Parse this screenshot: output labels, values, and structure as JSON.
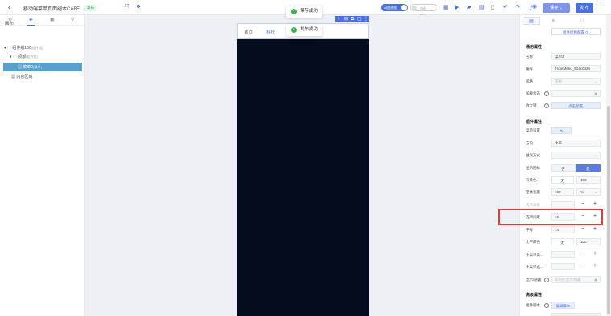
{
  "header": {
    "back_icon": "chevron-left-icon",
    "title": "移动端菜单页面副本CAFE",
    "status_badge": "发布",
    "toggle_debug": "动态数据",
    "toggle_auto": "自动保存",
    "save_label": "保存",
    "publish_label": "发 布",
    "more_label": "···",
    "toolbar_icons": [
      "fullscreen-icon",
      "sitemap-icon",
      "grid-icon",
      "play-icon",
      "bookmark-icon",
      "calendar-icon",
      "device-icon",
      "undo-icon",
      "redo-icon",
      "share-icon",
      "preview-icon"
    ]
  },
  "toasts": [
    {
      "text": "保存成功"
    },
    {
      "text": "发布成功"
    }
  ],
  "left_panel": {
    "tabs": [
      "settings-icon",
      "layers-icon",
      "components-icon",
      "tree-icon"
    ],
    "section_label": "画布",
    "tree": [
      {
        "label": "组件组100",
        "sub": "(组件组)"
      },
      {
        "label": "顶部",
        "sub": "(组件组)"
      },
      {
        "label": "菜单2",
        "sub": "(菜单)"
      },
      {
        "label": "内容区域",
        "sub": ""
      }
    ]
  },
  "canvas": {
    "menu_items": [
      "首页",
      "科技"
    ],
    "tool_icons": [
      "+",
      "⊟",
      "⧉",
      "▢",
      "⋮"
    ]
  },
  "right_panel": {
    "tabs": [
      "props-icon",
      "style-icon",
      "event-icon"
    ],
    "top_button": "组件结构配置",
    "group_general": "通用属性",
    "name_label": "名称",
    "name_value": "菜单2",
    "id_label": "编号",
    "id_value": "FrontMenu_914c0424",
    "style_label": "风格",
    "style_value": "风格",
    "loading_label": "加载状态",
    "zoom_label": "放大镜",
    "zoom_button": "点击配置",
    "group_component": "组件属性",
    "menu_settings_label": "菜单设置",
    "direction_label": "方向",
    "direction_value": "水平",
    "trigger_label": "触发方式",
    "show_icon_label": "显示图标",
    "show_icon_options": [
      "否",
      "是"
    ],
    "bg_color_label": "背景色",
    "bg_color_left": "无",
    "bg_color_right": "100",
    "width_label": "整体宽度",
    "width_value": "100",
    "width_unit": "%",
    "height_label": "选项高度",
    "gap_label": "选项间距",
    "gap_value": "10",
    "font_size_label": "字号",
    "font_size_value": "14",
    "text_color_label": "文字颜色",
    "text_color_left": "无",
    "text_color_right": "100",
    "sub_menu_label_1": "子菜单高...",
    "sub_menu_label_2": "子菜单选...",
    "show_hide_label": "显示/隐藏",
    "show_hide_placeholder": "如何控显示/隐藏",
    "group_advanced": "高级属性",
    "script_label": "组件脚本",
    "script_button": "编辑脚本",
    "minus": "−",
    "plus": "+",
    "qmark": "?"
  },
  "colors": {
    "accent": "#4a6fe0",
    "phone_bg": "#040c1e",
    "highlight": "#e53935",
    "success": "#38b04a"
  }
}
